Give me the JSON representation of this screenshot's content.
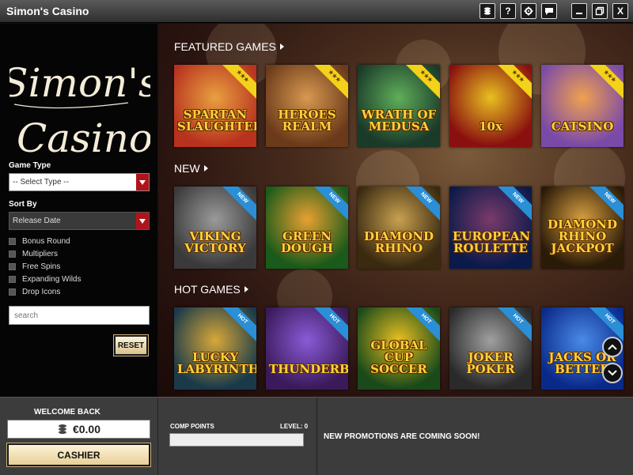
{
  "window": {
    "title": "Simon's Casino",
    "buttons": [
      {
        "name": "coins-icon",
        "label": ""
      },
      {
        "name": "help-icon",
        "label": "?"
      },
      {
        "name": "gear-icon",
        "label": ""
      },
      {
        "name": "chat-icon",
        "label": ""
      },
      {
        "name": "minimize-icon",
        "label": ""
      },
      {
        "name": "maximize-icon",
        "label": ""
      },
      {
        "name": "close-icon",
        "label": "X"
      }
    ]
  },
  "sidebar": {
    "logo_line1": "Simon's",
    "logo_line2": "Casino",
    "game_type_label": "Game Type",
    "game_type_value": "-- Select Type --",
    "sort_by_label": "Sort By",
    "sort_by_value": "Release Date",
    "filters": [
      "Bonus Round",
      "Multipliers",
      "Free Spins",
      "Expanding Wilds",
      "Drop Icons"
    ],
    "search_placeholder": "search",
    "reset_label": "RESET"
  },
  "sections": [
    {
      "title": "FEATURED GAMES",
      "ribbon": "★★★",
      "ribbon_style": "gold",
      "games": [
        {
          "name": "SPARTAN\nSLAUGHTER",
          "colors": [
            "#b8321e",
            "#e8a040"
          ]
        },
        {
          "name": "HEROES\nREALM",
          "colors": [
            "#6a3a1a",
            "#d89850"
          ]
        },
        {
          "name": "WRATH OF\nMEDUSA",
          "colors": [
            "#1a3a2a",
            "#5fae5a"
          ]
        },
        {
          "name": "10x",
          "colors": [
            "#8a1010",
            "#e8c020"
          ]
        },
        {
          "name": "CATSINO",
          "colors": [
            "#7a4aa8",
            "#f0a050"
          ]
        }
      ]
    },
    {
      "title": "NEW",
      "ribbon": "NEW",
      "ribbon_style": "blue",
      "games": [
        {
          "name": "VIKING\nVICTORY",
          "colors": [
            "#3a3a3a",
            "#9a9a9a"
          ]
        },
        {
          "name": "GREEN\nDOUGH",
          "colors": [
            "#1a5a1a",
            "#e8a030"
          ]
        },
        {
          "name": "DIAMOND\nRHINO",
          "colors": [
            "#3a2a10",
            "#c8a050"
          ]
        },
        {
          "name": "EUROPEAN\nROULETTE",
          "colors": [
            "#0a1a4a",
            "#7a3a6a"
          ]
        },
        {
          "name": "DIAMOND\nRHINO\nJACKPOT",
          "colors": [
            "#2a1a08",
            "#d8a040"
          ]
        }
      ]
    },
    {
      "title": "HOT GAMES",
      "ribbon": "HOT",
      "ribbon_style": "blue",
      "games": [
        {
          "name": "LUCKY\nLABYRINTH",
          "colors": [
            "#1a3a4a",
            "#d8a838"
          ]
        },
        {
          "name": "THUNDERBIRD",
          "colors": [
            "#3a1a5a",
            "#8a5ad8"
          ]
        },
        {
          "name": "GLOBAL CUP\nSOCCER",
          "colors": [
            "#1a4a1a",
            "#e8c020"
          ]
        },
        {
          "name": "JOKER\nPOKER",
          "colors": [
            "#2a2a2a",
            "#a0a0a0"
          ]
        },
        {
          "name": "JACKS OR\nBETTER",
          "colors": [
            "#0a2a8a",
            "#4a8ae8"
          ]
        }
      ]
    }
  ],
  "footer": {
    "welcome": "WELCOME BACK",
    "balance": "€0.00",
    "cashier": "CASHIER",
    "comp_points_label": "COMP POINTS",
    "level_label": "LEVEL: 0",
    "comp_progress": 0,
    "promo": "NEW PROMOTIONS ARE COMING SOON!"
  },
  "colors": {
    "accent_red": "#b0141b",
    "gold_ribbon": "#f2d21a",
    "blue_ribbon": "#2a8fd6"
  }
}
